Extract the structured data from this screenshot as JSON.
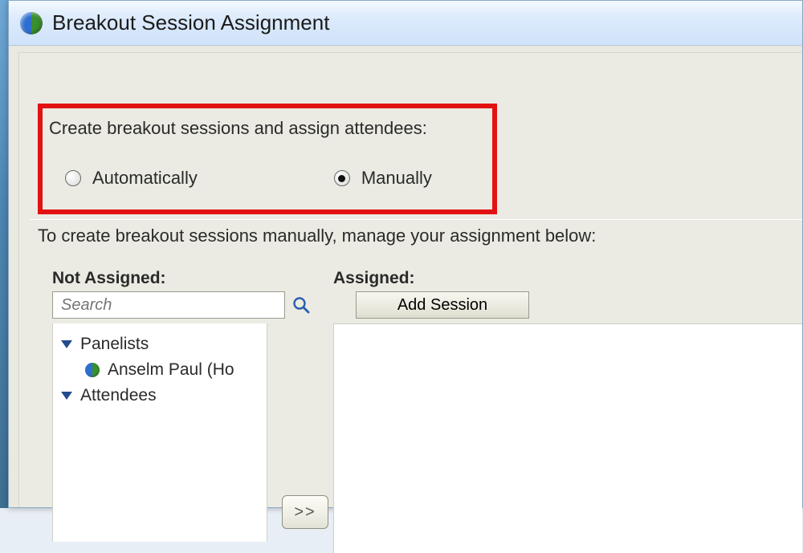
{
  "window": {
    "title": "Breakout Session Assignment"
  },
  "mode": {
    "caption": "Create breakout sessions and assign attendees:",
    "options": {
      "automatic": "Automatically",
      "manual": "Manually"
    },
    "selected": "manual"
  },
  "instruction": "To create breakout sessions manually, manage your assignment below:",
  "columns": {
    "left_label": "Not Assigned:",
    "right_label": "Assigned:"
  },
  "search": {
    "placeholder": "Search"
  },
  "tree": {
    "groups": [
      {
        "label": "Panelists",
        "expanded": true,
        "items": [
          {
            "label": "Anselm Paul (Ho"
          }
        ]
      },
      {
        "label": "Attendees",
        "expanded": true,
        "items": []
      }
    ]
  },
  "buttons": {
    "move_right": ">>",
    "add_session": "Add Session"
  }
}
